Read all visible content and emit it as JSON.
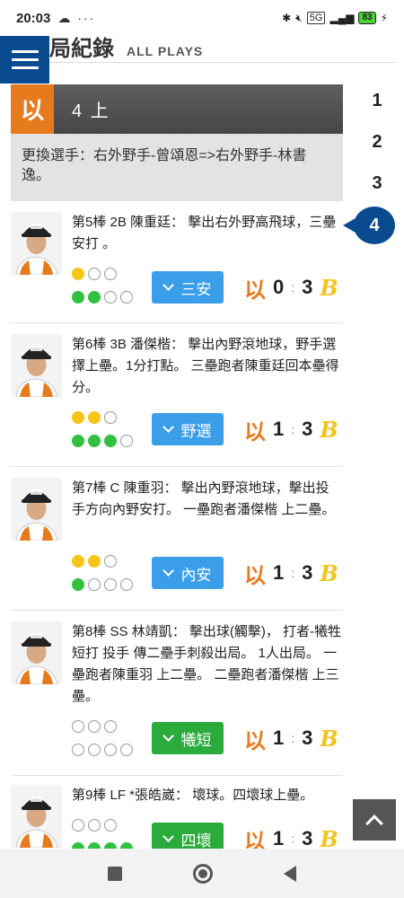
{
  "status_bar": {
    "time": "20:03",
    "left_icons": "☁ ···",
    "network": "5G",
    "battery": "83"
  },
  "header": {
    "title": "局紀錄",
    "title_en": "ALL PLAYS"
  },
  "inning": {
    "logo_text": "以",
    "label": "4 上",
    "substitution": "更換選手：右外野手-曾頌恩=>右外野手-林書逸。"
  },
  "inning_nav": {
    "items": [
      "1",
      "2",
      "3"
    ],
    "active": "4"
  },
  "team_logos": {
    "home": "以",
    "away": "B"
  },
  "plays": [
    {
      "text": "第5棒 2B 陳重廷： 擊出右外野高飛球，三壘安打 。",
      "outs": [
        1,
        0,
        0
      ],
      "bases": [
        1,
        1,
        0,
        0
      ],
      "result": "三安",
      "result_color": "blue",
      "home": "0",
      "away": "3"
    },
    {
      "text": "第6棒 3B 潘傑楷： 擊出內野滾地球，野手選擇上壘。1分打點。 三壘跑者陳重廷回本壘得分。",
      "outs": [
        1,
        1,
        0
      ],
      "bases": [
        1,
        1,
        1,
        0
      ],
      "result": "野選",
      "result_color": "blue",
      "home": "1",
      "away": "3"
    },
    {
      "text": "第7棒 C 陳重羽： 擊出內野滾地球，擊出投手方向內野安打。 一壘跑者潘傑楷 上二壘。",
      "outs": [
        1,
        1,
        0
      ],
      "bases": [
        1,
        0,
        0,
        0
      ],
      "result": "內安",
      "result_color": "blue",
      "home": "1",
      "away": "3"
    },
    {
      "text": "第8棒 SS 林靖凱： 擊出球(觸擊)， 打者-犧牲短打 投手 傳二壘手刺殺出局。 1人出局。 一壘跑者陳重羽 上二壘。 二壘跑者潘傑楷 上三壘。",
      "outs": [
        0,
        0,
        0
      ],
      "bases": [
        0,
        0,
        0,
        0
      ],
      "result": "犧短",
      "result_color": "green",
      "home": "1",
      "away": "3"
    },
    {
      "text": "第9棒 LF *張皓崴： 壞球。四壞球上壘。",
      "outs": [
        0,
        0,
        0
      ],
      "bases": [
        1,
        1,
        1,
        1
      ],
      "result": "四壞",
      "result_color": "green",
      "home": "1",
      "away": "3"
    }
  ]
}
